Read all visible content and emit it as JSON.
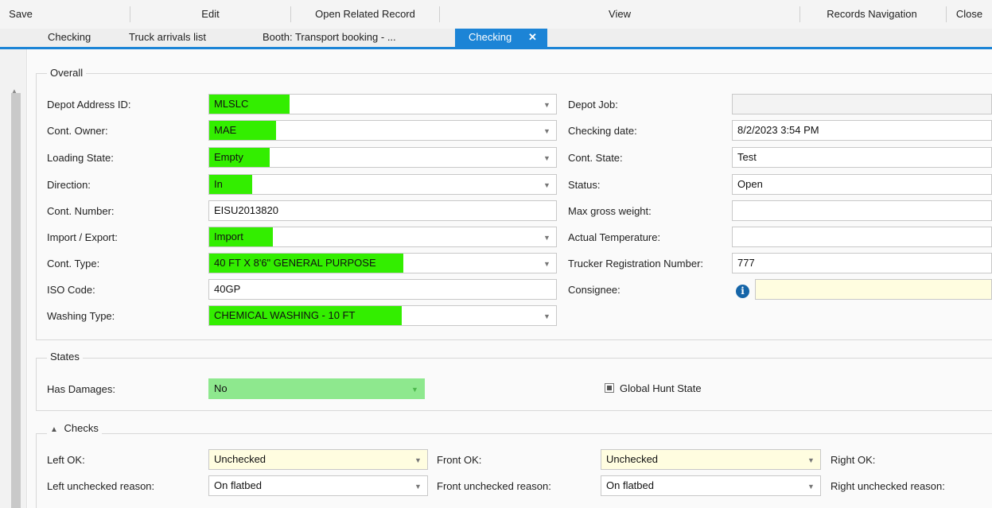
{
  "ribbon": {
    "save": "Save",
    "edit": "Edit",
    "open_related": "Open Related Record",
    "view": "View",
    "records_navigation": "Records Navigation",
    "close": "Close"
  },
  "tabs": [
    {
      "label": "Checking"
    },
    {
      "label": "Truck arrivals list"
    },
    {
      "label": "Booth: Transport booking - ..."
    },
    {
      "label": "Checking",
      "close": "✕"
    }
  ],
  "overall": {
    "title": "Overall",
    "depot_address_id": {
      "label": "Depot Address ID:",
      "value": "MLSLC"
    },
    "cont_owner": {
      "label": "Cont. Owner:",
      "value": "MAE"
    },
    "loading_state": {
      "label": "Loading State:",
      "value": "Empty"
    },
    "direction": {
      "label": "Direction:",
      "value": "In"
    },
    "cont_number": {
      "label": "Cont. Number:",
      "value": "EISU2013820"
    },
    "import_export": {
      "label": "Import / Export:",
      "value": "Import"
    },
    "cont_type": {
      "label": "Cont. Type:",
      "value": "40 FT X 8'6\" GENERAL PURPOSE"
    },
    "iso_code": {
      "label": "ISO Code:",
      "value": "40GP"
    },
    "washing_type": {
      "label": "Washing Type:",
      "value": "CHEMICAL WASHING - 10 FT"
    },
    "depot_job": {
      "label": "Depot Job:",
      "value": ""
    },
    "checking_date": {
      "label": "Checking date:",
      "value": "8/2/2023 3:54 PM"
    },
    "cont_state": {
      "label": "Cont. State:",
      "value": "Test"
    },
    "status": {
      "label": "Status:",
      "value": "Open"
    },
    "max_gross_weight": {
      "label": "Max gross weight:",
      "value": ""
    },
    "actual_temperature": {
      "label": "Actual Temperature:",
      "value": ""
    },
    "trucker_registration": {
      "label": "Trucker Registration Number:",
      "value": "777"
    },
    "consignee": {
      "label": "Consignee:",
      "value": ""
    }
  },
  "states": {
    "title": "States",
    "has_damages": {
      "label": "Has Damages:",
      "value": "No"
    },
    "global_hunt_state": {
      "label": "Global Hunt State"
    }
  },
  "checks": {
    "title": "Checks",
    "left_ok": {
      "label": "Left OK:",
      "value": "Unchecked"
    },
    "front_ok": {
      "label": "Front OK:",
      "value": "Unchecked"
    },
    "right_ok": {
      "label": "Right OK:"
    },
    "left_reason": {
      "label": "Left unchecked reason:",
      "value": "On flatbed"
    },
    "front_reason": {
      "label": "Front unchecked reason:",
      "value": "On flatbed"
    },
    "right_reason": {
      "label": "Right unchecked reason:"
    }
  },
  "colors": {
    "accent": "#1c84d6",
    "highlight": "#33ee00",
    "yes_no_field": "#8ee88e",
    "unchecked_field": "#fffde0"
  }
}
